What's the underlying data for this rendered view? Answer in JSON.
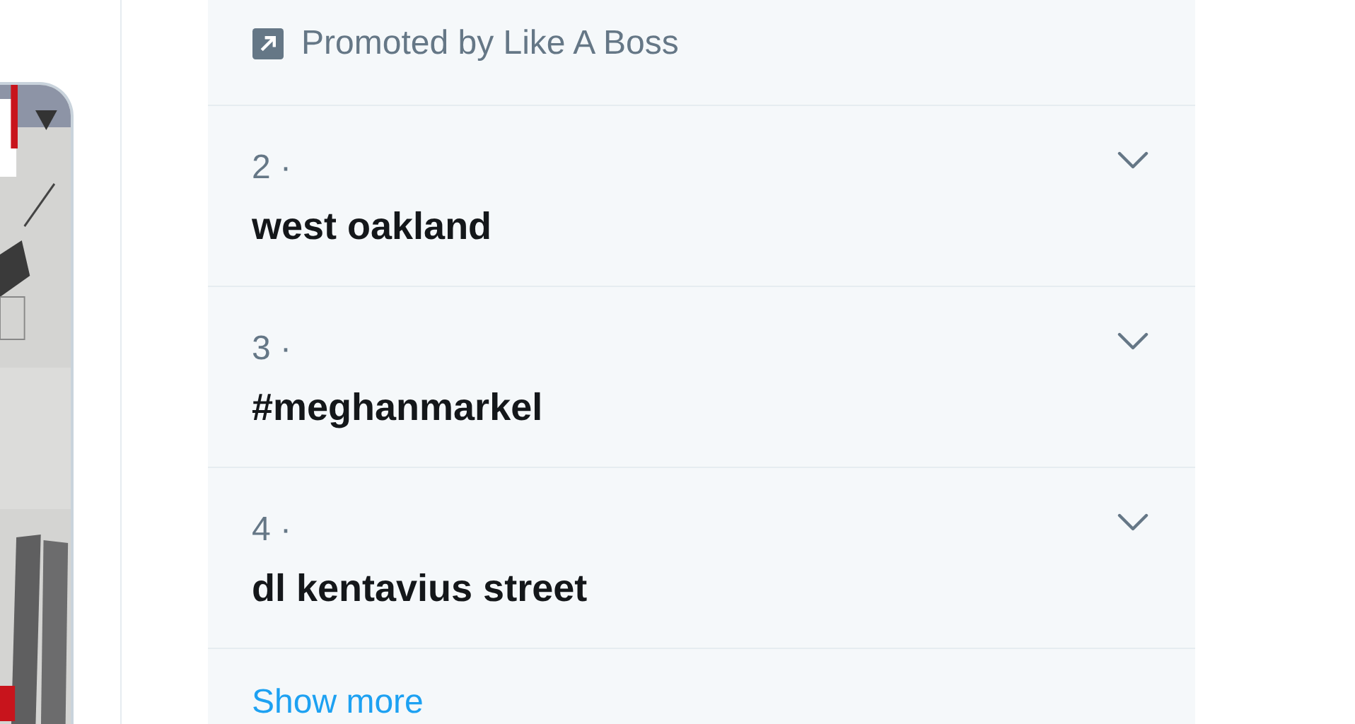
{
  "trends_panel": {
    "promoted": {
      "text": "Promoted by Like A Boss"
    },
    "trends": [
      {
        "rank": "2 ·",
        "name": "west oakland"
      },
      {
        "rank": "3 ·",
        "name": "#meghanmarkel"
      },
      {
        "rank": "4 ·",
        "name": "dl kentavius street"
      }
    ],
    "show_more": "Show more"
  }
}
